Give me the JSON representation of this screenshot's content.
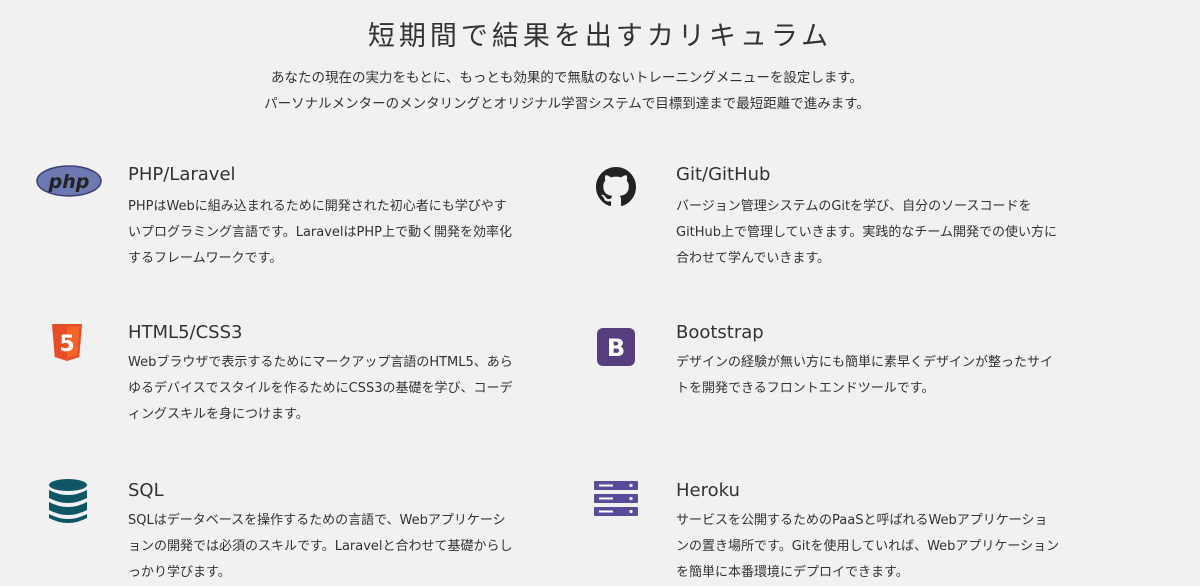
{
  "section": {
    "title": "短期間で結果を出すカリキュラム",
    "lead_line1": "あなたの現在の実力をもとに、もっとも効果的で無駄のないトレーニングメニューを設定します。",
    "lead_line2": "パーソナルメンターのメンタリングとオリジナル学習システムで目標到達まで最短距離で進みます。"
  },
  "courses": [
    {
      "icon": "php-logo-icon",
      "icon_color": "#6e78b1",
      "icon_text": "php",
      "title": "PHP/Laravel",
      "description": "PHPはWebに組み込まれるために開発された初心者にも学びやすいプログラミング言語です。LaravelはPHP上で動く開発を効率化するフレームワークです。",
      "lines": [
        "PHPはWebに組み込まれるために開発された初心者にも学びやす",
        "いプログラミング言語です。LaravelはPHP上で動く開発を効率化",
        "するフレームワークです。"
      ]
    },
    {
      "icon": "github-icon",
      "icon_color": "#222222",
      "title": "Git/GitHub",
      "lines": [
        "バージョン管理システムのGitを学び、自分のソースコードを",
        "GitHub上で管理していきます。実践的なチーム開発での使い方に",
        "合わせて学んでいきます。"
      ]
    },
    {
      "icon": "html5-icon",
      "icon_color": "#e44d26",
      "icon_text": "5",
      "title": "HTML5/CSS3",
      "lines": [
        "Webブラウザで表示するためにマークアップ言語のHTML5、あら",
        "ゆるデバイスでスタイルを作るためにCSS3の基礎を学び、コーデ",
        "ィングスキルを身につけます。"
      ]
    },
    {
      "icon": "bootstrap-icon",
      "icon_color": "#563d7c",
      "icon_text": "B",
      "title": "Bootstrap",
      "lines": [
        "デザインの経験が無い方にも簡単に素早くデザインが整ったサイ",
        "トを開発できるフロントエンドツールです。"
      ]
    },
    {
      "icon": "database-icon",
      "icon_color": "#0e5566",
      "title": "SQL",
      "lines": [
        "SQLはデータベースを操作するための言語で、Webアプリケーシ",
        "ョンの開発では必須のスキルです。Laravelと合わせて基礎からし",
        "っかり学びます。"
      ]
    },
    {
      "icon": "server-icon",
      "icon_color": "#5a4b9a",
      "title": "Heroku",
      "lines": [
        "サービスを公開するためのPaaSと呼ばれるWebアプリケーショ",
        "ンの置き場所です。Gitを使用していれば、Webアプリケーション",
        "を簡単に本番環境にデプロイできます。"
      ]
    }
  ]
}
